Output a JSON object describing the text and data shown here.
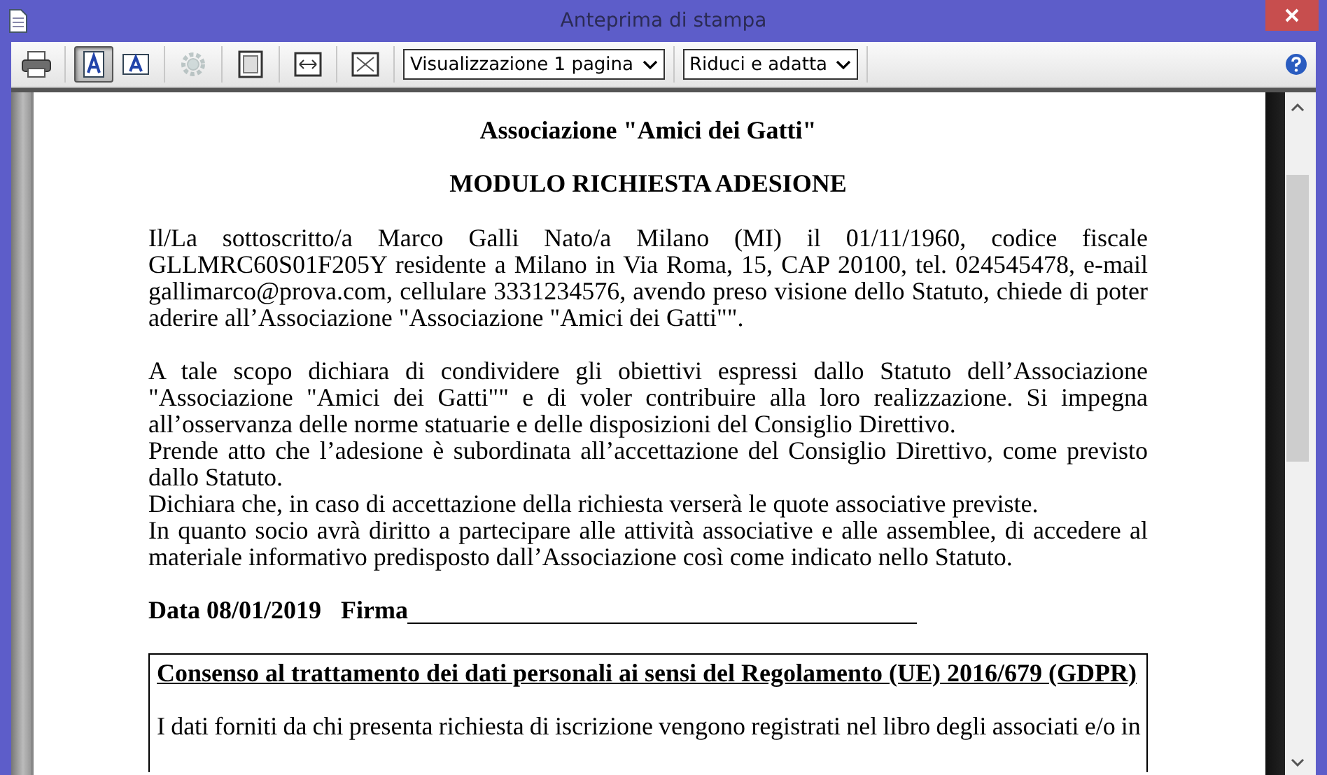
{
  "window": {
    "title": "Anteprima di stampa"
  },
  "toolbar": {
    "tools": [
      {
        "kind": "print",
        "selected": false,
        "disabled": false
      },
      {
        "kind": "portrait",
        "selected": true,
        "disabled": false
      },
      {
        "kind": "landscape",
        "selected": false,
        "disabled": false
      },
      {
        "kind": "settings",
        "selected": false,
        "disabled": true
      },
      {
        "kind": "page",
        "selected": false,
        "disabled": false
      },
      {
        "kind": "fit-width",
        "selected": false,
        "disabled": false
      },
      {
        "kind": "fit-page",
        "selected": false,
        "disabled": false
      }
    ],
    "dropdowns": [
      {
        "value": "Visualizzazione 1 pagina"
      },
      {
        "value": "Riduci e adatta"
      }
    ]
  },
  "document": {
    "heading": "Associazione \"Amici dei Gatti\"",
    "title": "MODULO RICHIESTA ADESIONE",
    "paragraphs": [
      "Il/La sottoscritto/a Marco Galli Nato/a Milano (MI) il 01/11/1960, codice fiscale GLLMRC60S01F205Y residente a Milano in Via Roma, 15, CAP 20100, tel. 024545478, e-mail gallimarco@prova.com, cellulare 3331234576, avendo preso visione dello Statuto, chiede di poter aderire all’Associazione \"Associazione \"Amici dei Gatti\"\".",
      "A tale scopo dichiara di condividere gli obiettivi espressi dallo Statuto dell’Associazione \"Associazione \"Amici dei Gatti\"\" e di voler contribuire alla loro realizzazione. Si impegna all’osservanza delle norme statuarie e delle disposizioni del Consiglio Direttivo.",
      "Prende atto che l’adesione è subordinata all’accettazione del Consiglio Direttivo, come previsto dallo Statuto.",
      "Dichiara che, in caso di accettazione della richiesta verserà le quote associative previste.",
      "In quanto socio avrà diritto a partecipare alle attività associative e alle assemblee, di accedere al materiale informativo predisposto dall’Associazione così come indicato nello Statuto."
    ],
    "date": "Data 08/01/2019",
    "signature_label": "Firma",
    "consent": {
      "title": "Consenso al trattamento dei dati personali ai sensi del Regolamento (UE) 2016/679 (GDPR)",
      "text": "I dati forniti da chi presenta richiesta di iscrizione vengono registrati nel libro degli associati e/o in"
    }
  }
}
